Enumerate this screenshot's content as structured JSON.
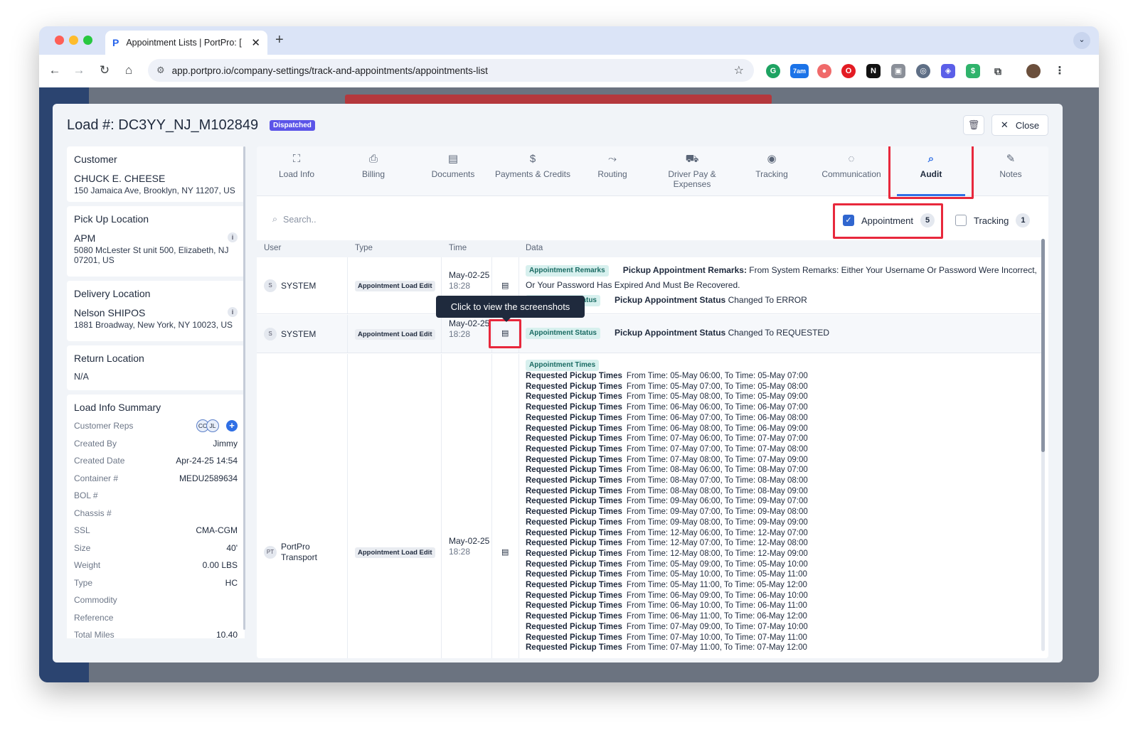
{
  "browser": {
    "tab_title": "Appointment Lists | PortPro: [",
    "favicon": "P",
    "url": "app.portpro.io/company-settings/track-and-appointments/appointments-list",
    "ext_calendar_label": "7am"
  },
  "modal": {
    "load_title": "Load #: DC3YY_NJ_M102849",
    "status_badge": "Dispatched",
    "close_label": "Close"
  },
  "sidebar": {
    "customer": {
      "heading": "Customer",
      "name": "CHUCK E. CHEESE",
      "address": "150 Jamaica Ave, Brooklyn, NY 11207, US"
    },
    "pickup": {
      "heading": "Pick Up Location",
      "name": "APM",
      "address": "5080 McLester St unit 500, Elizabeth, NJ 07201, US"
    },
    "delivery": {
      "heading": "Delivery Location",
      "name": "Nelson SHIPOS",
      "address": "1881 Broadway, New York, NY 10023, US"
    },
    "return_loc": {
      "heading": "Return Location",
      "value": "N/A"
    },
    "summary": {
      "heading": "Load Info Summary",
      "reps_label": "Customer Reps",
      "reps": [
        "CC",
        "JL"
      ],
      "rows": [
        {
          "k": "Created By",
          "v": "Jimmy"
        },
        {
          "k": "Created Date",
          "v": "Apr-24-25 14:54"
        },
        {
          "k": "Container #",
          "v": "MEDU2589634"
        },
        {
          "k": "BOL #",
          "v": ""
        },
        {
          "k": "Chassis #",
          "v": ""
        },
        {
          "k": "SSL",
          "v": "CMA-CGM"
        },
        {
          "k": "Size",
          "v": "40'"
        },
        {
          "k": "Weight",
          "v": "0.00 LBS"
        },
        {
          "k": "Type",
          "v": "HC"
        },
        {
          "k": "Commodity",
          "v": ""
        },
        {
          "k": "Reference",
          "v": ""
        },
        {
          "k": "Total Miles",
          "v": "10.40"
        }
      ]
    }
  },
  "tabs": [
    {
      "label": "Load Info",
      "icon": "scan-icon"
    },
    {
      "label": "Billing",
      "icon": "receipt-icon"
    },
    {
      "label": "Documents",
      "icon": "document-icon"
    },
    {
      "label": "Payments & Credits",
      "icon": "dollar-icon"
    },
    {
      "label": "Routing",
      "icon": "route-icon"
    },
    {
      "label": "Driver Pay & Expenses",
      "icon": "truck-icon"
    },
    {
      "label": "Tracking",
      "icon": "location-icon"
    },
    {
      "label": "Communication",
      "icon": "chat-icon"
    },
    {
      "label": "Audit",
      "icon": "audit-icon",
      "active": true
    },
    {
      "label": "Notes",
      "icon": "notes-icon"
    }
  ],
  "filters": {
    "search_placeholder": "Search..",
    "appointment": {
      "label": "Appointment",
      "count": "5",
      "checked": true
    },
    "tracking": {
      "label": "Tracking",
      "count": "1",
      "checked": false
    }
  },
  "table": {
    "headers": {
      "user": "User",
      "type": "Type",
      "time": "Time",
      "data": "Data"
    },
    "rows": [
      {
        "user_initial": "S",
        "user": "SYSTEM",
        "type": "Appointment Load Edit",
        "date": "May-02-25",
        "time": "18:28",
        "tag1": "Appointment Remarks",
        "field1": "Pickup Appointment Remarks:",
        "text1": "From System Remarks: Either Your Username Or Password Were Incorrect, Or Your Password Has Expired And Must Be Recovered.",
        "tag2": "Appointment Status",
        "field2": "Pickup Appointment Status",
        "text2": "Changed To ERROR"
      },
      {
        "user_initial": "S",
        "user": "SYSTEM",
        "type": "Appointment Load Edit",
        "date": "May-02-25",
        "time": "18:28",
        "tag1": "Appointment Status",
        "field1": "Pickup Appointment Status",
        "text1": "Changed To REQUESTED"
      },
      {
        "user_initial": "PT",
        "user": "PortPro Transport",
        "type": "Appointment Load Edit",
        "date": "May-02-25",
        "time": "18:28",
        "tag1": "Appointment Times",
        "times_label": "Requested Pickup Times",
        "times": [
          "From Time: 05-May 06:00, To Time: 05-May 07:00",
          "From Time: 05-May 07:00, To Time: 05-May 08:00",
          "From Time: 05-May 08:00, To Time: 05-May 09:00",
          "From Time: 06-May 06:00, To Time: 06-May 07:00",
          "From Time: 06-May 07:00, To Time: 06-May 08:00",
          "From Time: 06-May 08:00, To Time: 06-May 09:00",
          "From Time: 07-May 06:00, To Time: 07-May 07:00",
          "From Time: 07-May 07:00, To Time: 07-May 08:00",
          "From Time: 07-May 08:00, To Time: 07-May 09:00",
          "From Time: 08-May 06:00, To Time: 08-May 07:00",
          "From Time: 08-May 07:00, To Time: 08-May 08:00",
          "From Time: 08-May 08:00, To Time: 08-May 09:00",
          "From Time: 09-May 06:00, To Time: 09-May 07:00",
          "From Time: 09-May 07:00, To Time: 09-May 08:00",
          "From Time: 09-May 08:00, To Time: 09-May 09:00",
          "From Time: 12-May 06:00, To Time: 12-May 07:00",
          "From Time: 12-May 07:00, To Time: 12-May 08:00",
          "From Time: 12-May 08:00, To Time: 12-May 09:00",
          "From Time: 05-May 09:00, To Time: 05-May 10:00",
          "From Time: 05-May 10:00, To Time: 05-May 11:00",
          "From Time: 05-May 11:00, To Time: 05-May 12:00",
          "From Time: 06-May 09:00, To Time: 06-May 10:00",
          "From Time: 06-May 10:00, To Time: 06-May 11:00",
          "From Time: 06-May 11:00, To Time: 06-May 12:00",
          "From Time: 07-May 09:00, To Time: 07-May 10:00",
          "From Time: 07-May 10:00, To Time: 07-May 11:00",
          "From Time: 07-May 11:00, To Time: 07-May 12:00"
        ]
      }
    ]
  },
  "tooltip": "Click to view the screenshots",
  "colors": {
    "accent": "#2f6fe5",
    "highlight": "#e8283c",
    "badge": "#5b54e8",
    "tag_bg": "#d7f0ee"
  }
}
